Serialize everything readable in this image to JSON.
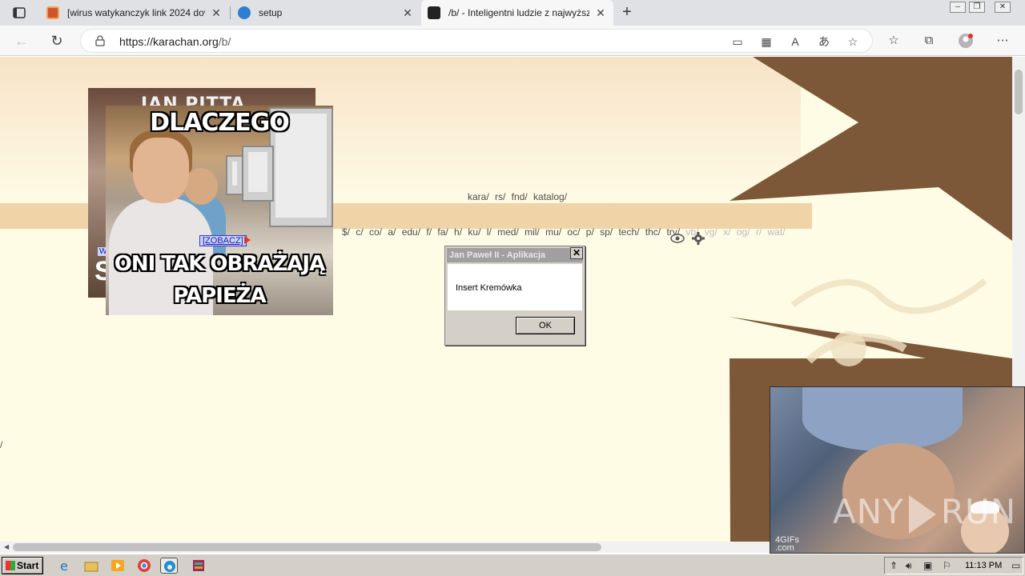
{
  "browser": {
    "tabs": [
      {
        "title": "[wirus watykanczyk link 2024 dov",
        "active": false
      },
      {
        "title": "setup",
        "active": false
      },
      {
        "title": "/b/ - Inteligentni ludzie z najwyższ",
        "active": true
      }
    ],
    "url_domain": "https://karachan.org",
    "url_path": "/b/"
  },
  "page": {
    "board_nav_top": "kara/ rs/ fnd/ katalog/",
    "board_nav_main": "$/ c/ co/ a/ edu/ f/ fa/ h/ ku/ l/ med/ mil/ mu/ oc/ p/ sp/ tech/ thc/ trv/",
    "board_nav_faded": "vb/ vg/ x/ og/ r/ wat/",
    "left_slash": "/",
    "meme_back": {
      "title": "JAN PITTA DRUGI",
      "letter": "S"
    },
    "meme_front": {
      "top_text": "DLACZEGO",
      "bottom_line1": "ONI TAK OBRAŻAJĄ",
      "bottom_line2": "PAPIEŻA"
    },
    "zobacz_link": "[ZOBACZ]",
    "w_tag": "W"
  },
  "dialog": {
    "title": "Jan Paweł II - Aplikacja",
    "message": "Insert Kremówka",
    "ok_label": "OK"
  },
  "gif": {
    "watermark_line1": "4GIFs",
    "watermark_line2": ".com",
    "overlay_left": "ANY",
    "overlay_right": "RUN"
  },
  "taskbar": {
    "start_label": "Start",
    "clock": "11:13 PM"
  },
  "colors": {
    "page_bg": "#fffce6",
    "brown": "#7d5838",
    "tan_band": "#f0d4a8"
  }
}
